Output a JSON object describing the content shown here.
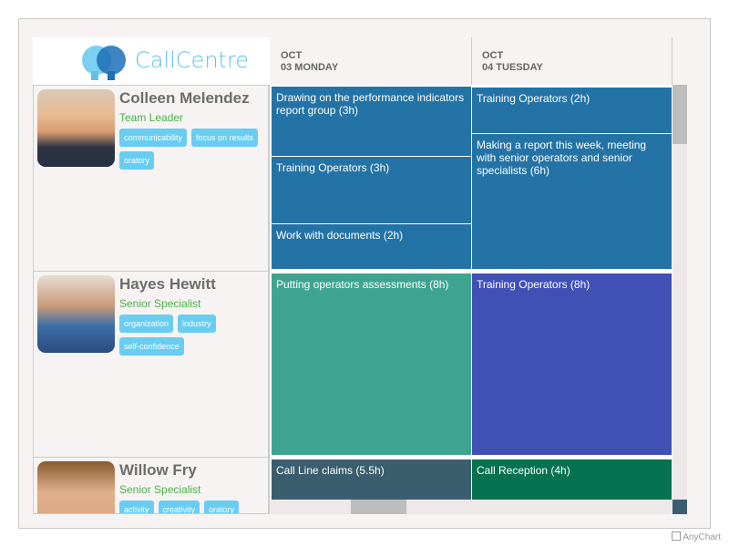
{
  "logo": {
    "text": "CallCentre"
  },
  "columns": [
    {
      "month": "OCT",
      "day": "03 MONDAY"
    },
    {
      "month": "OCT",
      "day": "04 TUESDAY"
    }
  ],
  "people": [
    {
      "name": "Colleen Melendez",
      "role": "Team Leader",
      "tags": [
        "communicability",
        "focus on results",
        "oratory"
      ]
    },
    {
      "name": "Hayes Hewitt",
      "role": "Senior Specialist",
      "tags": [
        "organization",
        "industry",
        "self-confidence"
      ]
    },
    {
      "name": "Willow Fry",
      "role": "Senior Specialist",
      "tags": [
        "activity",
        "creativity",
        "oratory"
      ]
    }
  ],
  "tasks": [
    {
      "text": "Drawing on the performance indicators report group (3h)",
      "color": "#2473a6"
    },
    {
      "text": "Training Operators (3h)",
      "color": "#2473a6"
    },
    {
      "text": "Work with documents (2h)",
      "color": "#2473a6"
    },
    {
      "text": "Training Operators (2h)",
      "color": "#2473a6"
    },
    {
      "text": "Making a report this week, meeting with senior operators and senior specialists (6h)",
      "color": "#2473a6"
    },
    {
      "text": "Putting operators assessments (8h)",
      "color": "#3fa48f"
    },
    {
      "text": "Training Operators (8h)",
      "color": "#4050b5"
    },
    {
      "text": "Call Line claims (5.5h)",
      "color": "#3b5e6e"
    },
    {
      "text": "Call Reception (4h)",
      "color": "#04724e"
    }
  ],
  "credit": "AnyChart"
}
